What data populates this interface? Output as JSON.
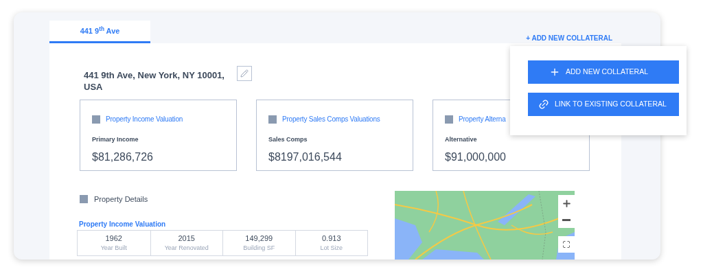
{
  "tabs": [
    {
      "label": "441 9$^{th}$ Ave",
      "selected": true
    }
  ],
  "add_link": "+ ADD NEW COLLATERAL",
  "address": "441 9th Ave, New York, NY 10001, USA",
  "valuation_cards": [
    {
      "title": "Property Income Valuation",
      "label": "Primary Income",
      "value": "$81,286,726"
    },
    {
      "title": "Property Sales Comps Valuations",
      "label": "Sales Comps",
      "value": "$8197,016,544"
    },
    {
      "title": "Property Alterna",
      "label": "Alternative",
      "value": "$91,000,000"
    }
  ],
  "details": {
    "title": "Property Details",
    "subtitle": "Property Income Valuation",
    "stats": [
      {
        "value": "1962",
        "label": "Year Built"
      },
      {
        "value": "2015",
        "label": "Year Renovated"
      },
      {
        "value": "149,299",
        "label": "Building SF"
      },
      {
        "value": "0.913",
        "label": "Lot Size"
      }
    ]
  },
  "menu": [
    {
      "kind": "add",
      "label": "ADD NEW COLLATERAL"
    },
    {
      "kind": "link",
      "label": "LINK TO EXISTING COLLATERAL"
    }
  ]
}
